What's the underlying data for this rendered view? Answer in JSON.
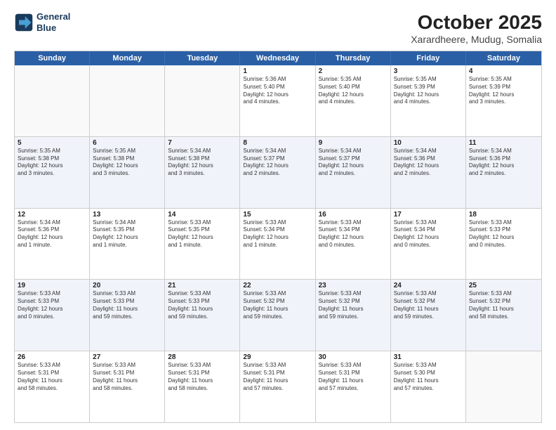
{
  "logo": {
    "line1": "General",
    "line2": "Blue"
  },
  "title": "October 2025",
  "location": "Xarardheere, Mudug, Somalia",
  "weekdays": [
    "Sunday",
    "Monday",
    "Tuesday",
    "Wednesday",
    "Thursday",
    "Friday",
    "Saturday"
  ],
  "rows": [
    [
      {
        "day": "",
        "info": "",
        "empty": true
      },
      {
        "day": "",
        "info": "",
        "empty": true
      },
      {
        "day": "",
        "info": "",
        "empty": true
      },
      {
        "day": "1",
        "info": "Sunrise: 5:36 AM\nSunset: 5:40 PM\nDaylight: 12 hours\nand 4 minutes."
      },
      {
        "day": "2",
        "info": "Sunrise: 5:35 AM\nSunset: 5:40 PM\nDaylight: 12 hours\nand 4 minutes."
      },
      {
        "day": "3",
        "info": "Sunrise: 5:35 AM\nSunset: 5:39 PM\nDaylight: 12 hours\nand 4 minutes."
      },
      {
        "day": "4",
        "info": "Sunrise: 5:35 AM\nSunset: 5:39 PM\nDaylight: 12 hours\nand 3 minutes."
      }
    ],
    [
      {
        "day": "5",
        "info": "Sunrise: 5:35 AM\nSunset: 5:38 PM\nDaylight: 12 hours\nand 3 minutes."
      },
      {
        "day": "6",
        "info": "Sunrise: 5:35 AM\nSunset: 5:38 PM\nDaylight: 12 hours\nand 3 minutes."
      },
      {
        "day": "7",
        "info": "Sunrise: 5:34 AM\nSunset: 5:38 PM\nDaylight: 12 hours\nand 3 minutes."
      },
      {
        "day": "8",
        "info": "Sunrise: 5:34 AM\nSunset: 5:37 PM\nDaylight: 12 hours\nand 2 minutes."
      },
      {
        "day": "9",
        "info": "Sunrise: 5:34 AM\nSunset: 5:37 PM\nDaylight: 12 hours\nand 2 minutes."
      },
      {
        "day": "10",
        "info": "Sunrise: 5:34 AM\nSunset: 5:36 PM\nDaylight: 12 hours\nand 2 minutes."
      },
      {
        "day": "11",
        "info": "Sunrise: 5:34 AM\nSunset: 5:36 PM\nDaylight: 12 hours\nand 2 minutes."
      }
    ],
    [
      {
        "day": "12",
        "info": "Sunrise: 5:34 AM\nSunset: 5:36 PM\nDaylight: 12 hours\nand 1 minute."
      },
      {
        "day": "13",
        "info": "Sunrise: 5:34 AM\nSunset: 5:35 PM\nDaylight: 12 hours\nand 1 minute."
      },
      {
        "day": "14",
        "info": "Sunrise: 5:33 AM\nSunset: 5:35 PM\nDaylight: 12 hours\nand 1 minute."
      },
      {
        "day": "15",
        "info": "Sunrise: 5:33 AM\nSunset: 5:34 PM\nDaylight: 12 hours\nand 1 minute."
      },
      {
        "day": "16",
        "info": "Sunrise: 5:33 AM\nSunset: 5:34 PM\nDaylight: 12 hours\nand 0 minutes."
      },
      {
        "day": "17",
        "info": "Sunrise: 5:33 AM\nSunset: 5:34 PM\nDaylight: 12 hours\nand 0 minutes."
      },
      {
        "day": "18",
        "info": "Sunrise: 5:33 AM\nSunset: 5:33 PM\nDaylight: 12 hours\nand 0 minutes."
      }
    ],
    [
      {
        "day": "19",
        "info": "Sunrise: 5:33 AM\nSunset: 5:33 PM\nDaylight: 12 hours\nand 0 minutes."
      },
      {
        "day": "20",
        "info": "Sunrise: 5:33 AM\nSunset: 5:33 PM\nDaylight: 11 hours\nand 59 minutes."
      },
      {
        "day": "21",
        "info": "Sunrise: 5:33 AM\nSunset: 5:33 PM\nDaylight: 11 hours\nand 59 minutes."
      },
      {
        "day": "22",
        "info": "Sunrise: 5:33 AM\nSunset: 5:32 PM\nDaylight: 11 hours\nand 59 minutes."
      },
      {
        "day": "23",
        "info": "Sunrise: 5:33 AM\nSunset: 5:32 PM\nDaylight: 11 hours\nand 59 minutes."
      },
      {
        "day": "24",
        "info": "Sunrise: 5:33 AM\nSunset: 5:32 PM\nDaylight: 11 hours\nand 59 minutes."
      },
      {
        "day": "25",
        "info": "Sunrise: 5:33 AM\nSunset: 5:32 PM\nDaylight: 11 hours\nand 58 minutes."
      }
    ],
    [
      {
        "day": "26",
        "info": "Sunrise: 5:33 AM\nSunset: 5:31 PM\nDaylight: 11 hours\nand 58 minutes."
      },
      {
        "day": "27",
        "info": "Sunrise: 5:33 AM\nSunset: 5:31 PM\nDaylight: 11 hours\nand 58 minutes."
      },
      {
        "day": "28",
        "info": "Sunrise: 5:33 AM\nSunset: 5:31 PM\nDaylight: 11 hours\nand 58 minutes."
      },
      {
        "day": "29",
        "info": "Sunrise: 5:33 AM\nSunset: 5:31 PM\nDaylight: 11 hours\nand 57 minutes."
      },
      {
        "day": "30",
        "info": "Sunrise: 5:33 AM\nSunset: 5:31 PM\nDaylight: 11 hours\nand 57 minutes."
      },
      {
        "day": "31",
        "info": "Sunrise: 5:33 AM\nSunset: 5:30 PM\nDaylight: 11 hours\nand 57 minutes."
      },
      {
        "day": "",
        "info": "",
        "empty": true
      }
    ]
  ]
}
